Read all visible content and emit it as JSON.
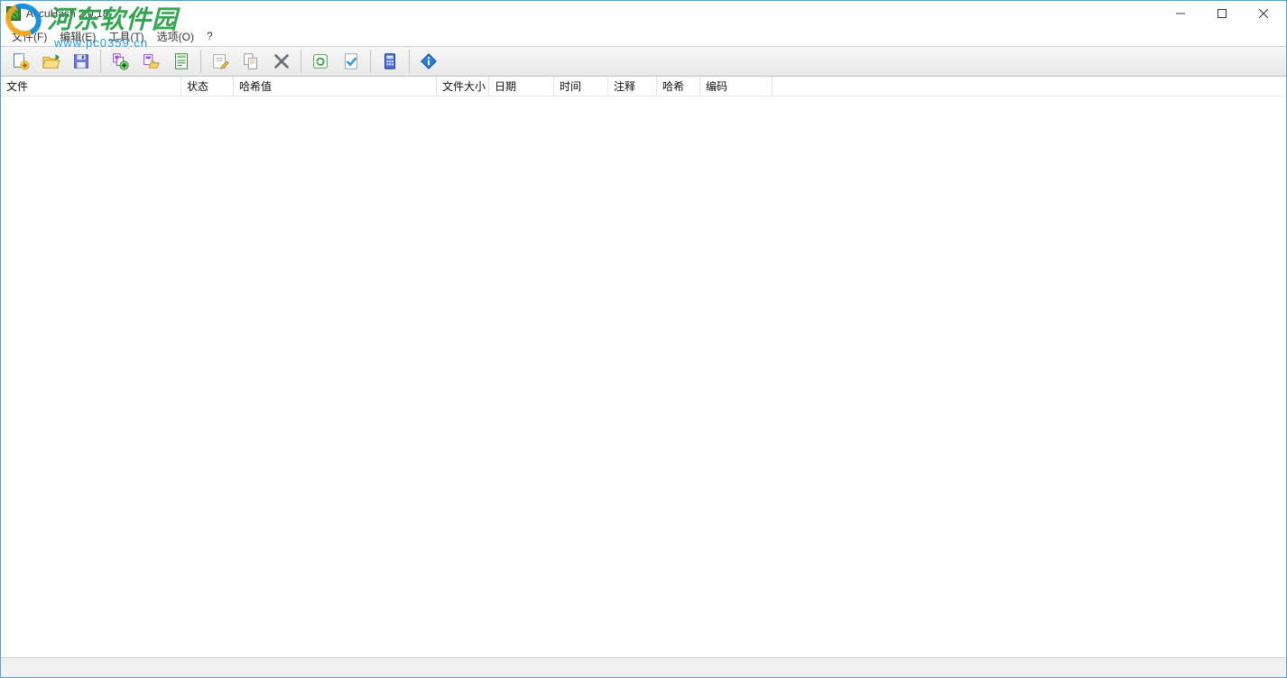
{
  "title": "AccuHash 2.0.18",
  "watermark": {
    "name": "河东软件园",
    "url": "www.pc0359.cn"
  },
  "menu": {
    "file": "文件(F)",
    "edit": "编辑(E)",
    "tools": "工具(T)",
    "options": "选项(O)",
    "help": "?"
  },
  "columns": {
    "file": "文件",
    "status": "状态",
    "hashvalue": "哈希值",
    "filesize": "文件大小",
    "date": "日期",
    "time": "时间",
    "comment": "注释",
    "hash": "哈希",
    "encoding": "编码"
  },
  "column_widths": {
    "file": 200,
    "status": 58,
    "hashvalue": 225,
    "filesize": 58,
    "date": 72,
    "time": 60,
    "comment": 54,
    "hash": 48,
    "encoding": 80
  }
}
